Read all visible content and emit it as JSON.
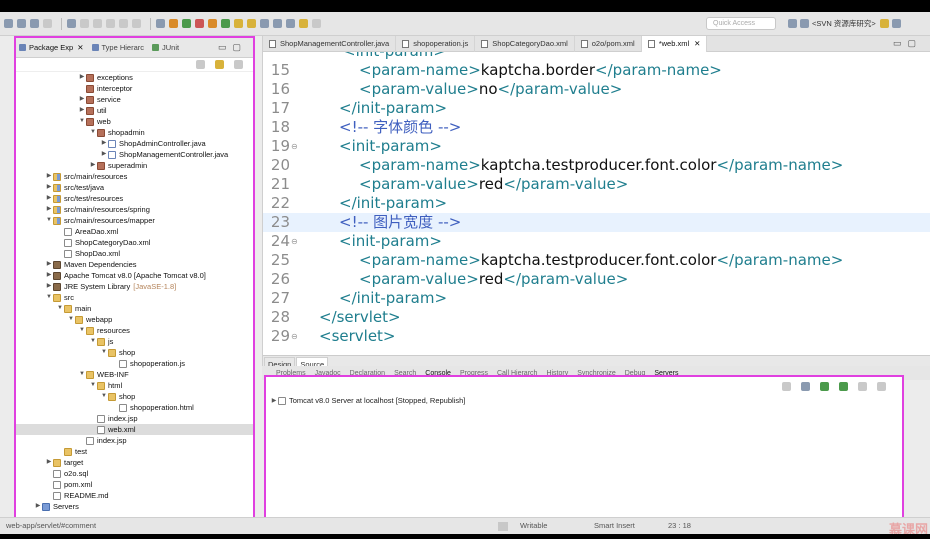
{
  "toolbar": {
    "quick_access": "Quick Access",
    "perspective": "<SVN 资源库研究>"
  },
  "left_panel": {
    "tabs": [
      "Package Exp",
      "Type Hierarc",
      "JUnit"
    ],
    "tree": [
      {
        "label": "exceptions",
        "depth": 4,
        "icon": "pkg",
        "arrow": "▶"
      },
      {
        "label": "interceptor",
        "depth": 4,
        "icon": "pkg",
        "arrow": ""
      },
      {
        "label": "service",
        "depth": 4,
        "icon": "pkg",
        "arrow": "▶"
      },
      {
        "label": "util",
        "depth": 4,
        "icon": "pkg",
        "arrow": "▶"
      },
      {
        "label": "web",
        "depth": 4,
        "icon": "pkg",
        "arrow": "▼"
      },
      {
        "label": "shopadmin",
        "depth": 5,
        "icon": "pkg",
        "arrow": "▼"
      },
      {
        "label": "ShopAdminController.java",
        "depth": 6,
        "icon": "java",
        "arrow": "▶"
      },
      {
        "label": "ShopManagementController.java",
        "depth": 6,
        "icon": "java",
        "arrow": "▶"
      },
      {
        "label": "superadmin",
        "depth": 5,
        "icon": "pkg",
        "arrow": "▶"
      },
      {
        "label": "src/main/resources",
        "depth": 1,
        "icon": "src",
        "arrow": "▶"
      },
      {
        "label": "src/test/java",
        "depth": 1,
        "icon": "src",
        "arrow": "▶"
      },
      {
        "label": "src/test/resources",
        "depth": 1,
        "icon": "src",
        "arrow": "▶"
      },
      {
        "label": "src/main/resources/spring",
        "depth": 1,
        "icon": "src",
        "arrow": "▶"
      },
      {
        "label": "src/main/resources/mapper",
        "depth": 1,
        "icon": "src",
        "arrow": "▼"
      },
      {
        "label": "AreaDao.xml",
        "depth": 2,
        "icon": "file",
        "arrow": ""
      },
      {
        "label": "ShopCategoryDao.xml",
        "depth": 2,
        "icon": "file",
        "arrow": ""
      },
      {
        "label": "ShopDao.xml",
        "depth": 2,
        "icon": "file",
        "arrow": ""
      },
      {
        "label": "Maven Dependencies",
        "depth": 1,
        "icon": "lib",
        "arrow": "▶"
      },
      {
        "label": "Apache Tomcat v8.0 [Apache Tomcat v8.0]",
        "depth": 1,
        "icon": "lib",
        "arrow": "▶"
      },
      {
        "label": "JRE System Library",
        "depth": 1,
        "icon": "lib",
        "arrow": "▶",
        "extra": "[JavaSE-1.8]"
      },
      {
        "label": "src",
        "depth": 1,
        "icon": "folder",
        "arrow": "▼"
      },
      {
        "label": "main",
        "depth": 2,
        "icon": "folder",
        "arrow": "▼"
      },
      {
        "label": "webapp",
        "depth": 3,
        "icon": "folder",
        "arrow": "▼"
      },
      {
        "label": "resources",
        "depth": 4,
        "icon": "folder",
        "arrow": "▼"
      },
      {
        "label": "js",
        "depth": 5,
        "icon": "folder",
        "arrow": "▼"
      },
      {
        "label": "shop",
        "depth": 6,
        "icon": "folder",
        "arrow": "▼"
      },
      {
        "label": "shopoperation.js",
        "depth": 7,
        "icon": "file",
        "arrow": ""
      },
      {
        "label": "WEB-INF",
        "depth": 4,
        "icon": "folder",
        "arrow": "▼"
      },
      {
        "label": "html",
        "depth": 5,
        "icon": "folder",
        "arrow": "▼"
      },
      {
        "label": "shop",
        "depth": 6,
        "icon": "folder",
        "arrow": "▼"
      },
      {
        "label": "shopoperation.html",
        "depth": 7,
        "icon": "file",
        "arrow": ""
      },
      {
        "label": "index.jsp",
        "depth": 5,
        "icon": "file",
        "arrow": ""
      },
      {
        "label": "web.xml",
        "depth": 5,
        "icon": "file",
        "arrow": "",
        "selected": true
      },
      {
        "label": "index.jsp",
        "depth": 4,
        "icon": "file",
        "arrow": ""
      },
      {
        "label": "test",
        "depth": 2,
        "icon": "folder",
        "arrow": ""
      },
      {
        "label": "target",
        "depth": 1,
        "icon": "folder",
        "arrow": "▶"
      },
      {
        "label": "o2o.sql",
        "depth": 1,
        "icon": "file",
        "arrow": ""
      },
      {
        "label": "pom.xml",
        "depth": 1,
        "icon": "file",
        "arrow": ""
      },
      {
        "label": "README.md",
        "depth": 1,
        "icon": "file",
        "arrow": ""
      },
      {
        "label": "Servers",
        "depth": 0,
        "icon": "proj",
        "arrow": "▶"
      }
    ]
  },
  "editor": {
    "tabs": [
      {
        "label": "ShopManagementController.java",
        "active": false
      },
      {
        "label": "shopoperation.js",
        "active": false
      },
      {
        "label": "ShopCategoryDao.xml",
        "active": false
      },
      {
        "label": "o2o/pom.xml",
        "active": false
      },
      {
        "label": "*web.xml",
        "active": true
      }
    ],
    "top_partial": "<init-param>",
    "lines": [
      {
        "num": "15",
        "indent": "  ",
        "segs": [
          {
            "t": "<param-name>",
            "c": "tag"
          },
          {
            "t": "kaptcha.border",
            "c": "txt"
          },
          {
            "t": "</param-name>",
            "c": "tag"
          }
        ]
      },
      {
        "num": "16",
        "indent": "  ",
        "segs": [
          {
            "t": "<param-value>",
            "c": "tag"
          },
          {
            "t": "no",
            "c": "txt"
          },
          {
            "t": "</param-value>",
            "c": "tag"
          }
        ]
      },
      {
        "num": "17",
        "indent": " ",
        "segs": [
          {
            "t": "</init-param>",
            "c": "tag"
          }
        ]
      },
      {
        "num": "18",
        "indent": " ",
        "segs": [
          {
            "t": "<!-- 字体颜色 -->",
            "c": "cm"
          }
        ]
      },
      {
        "num": "19",
        "indent": " ",
        "fold": "⊖",
        "segs": [
          {
            "t": "<init-param>",
            "c": "tag"
          }
        ]
      },
      {
        "num": "20",
        "indent": "  ",
        "segs": [
          {
            "t": "<param-name>",
            "c": "tag"
          },
          {
            "t": "kaptcha.testproducer.font.color",
            "c": "txt"
          },
          {
            "t": "</param-name>",
            "c": "tag"
          }
        ]
      },
      {
        "num": "21",
        "indent": "  ",
        "segs": [
          {
            "t": "<param-value>",
            "c": "tag"
          },
          {
            "t": "red",
            "c": "txt"
          },
          {
            "t": "</param-value>",
            "c": "tag"
          }
        ]
      },
      {
        "num": "22",
        "indent": " ",
        "segs": [
          {
            "t": "</init-param>",
            "c": "tag"
          }
        ]
      },
      {
        "num": "23",
        "indent": " ",
        "hl": true,
        "segs": [
          {
            "t": "<!-- 图片宽度 -->",
            "c": "cm"
          }
        ]
      },
      {
        "num": "24",
        "indent": " ",
        "fold": "⊖",
        "segs": [
          {
            "t": "<init-param>",
            "c": "tag"
          }
        ]
      },
      {
        "num": "25",
        "indent": "  ",
        "segs": [
          {
            "t": "<param-name>",
            "c": "tag"
          },
          {
            "t": "kaptcha.testproducer.font.color",
            "c": "txt"
          },
          {
            "t": "</param-name>",
            "c": "tag"
          }
        ]
      },
      {
        "num": "26",
        "indent": "  ",
        "segs": [
          {
            "t": "<param-value>",
            "c": "tag"
          },
          {
            "t": "red",
            "c": "txt"
          },
          {
            "t": "</param-value>",
            "c": "tag"
          }
        ]
      },
      {
        "num": "27",
        "indent": " ",
        "segs": [
          {
            "t": "</init-param>",
            "c": "tag"
          }
        ]
      },
      {
        "num": "28",
        "indent": "",
        "segs": [
          {
            "t": "</servlet>",
            "c": "tag"
          }
        ]
      },
      {
        "num": "29",
        "indent": "",
        "fold": "⊖",
        "segs": [
          {
            "t": "<servlet>",
            "c": "tag"
          }
        ]
      }
    ],
    "bottom_tabs": [
      "Design",
      "Source"
    ]
  },
  "views": [
    "Problems",
    "Javadoc",
    "Declaration",
    "Search",
    "Console",
    "Progress",
    "Call Hierarch",
    "History",
    "Synchronize",
    "Debug",
    "Servers"
  ],
  "servers": {
    "entry": "Tomcat v8.0 Server at localhost  [Stopped, Republish]"
  },
  "status": {
    "path": "web-app/servlet/#comment",
    "mode": "Writable",
    "insert": "Smart Insert",
    "position": "23 : 18",
    "watermark": "慕课网"
  }
}
